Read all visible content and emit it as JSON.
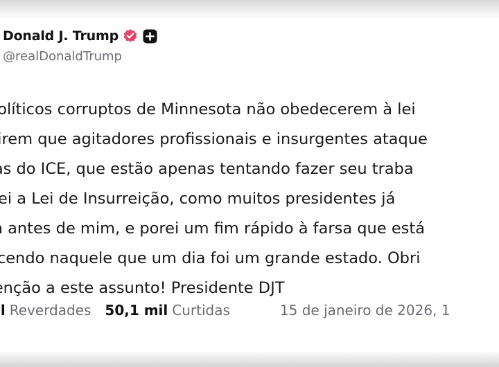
{
  "post": {
    "author": {
      "display_name": "Donald J. Trump",
      "handle": "@realDonaldTrump",
      "verified_badge_color": "#e3456a"
    },
    "text_lines": [
      "políticos corruptos de Minnesota não obedecerem à lei",
      "direm que agitadores profissionais e insurgentes ataque",
      "tas do ICE, que estão apenas tentando fazer seu traba",
      "írei a Lei de Insurreição, como muitos presidentes já",
      "m antes de mim, e porei um fim rápido à farsa que está",
      "ecendo naquele que um dia foi um grande estado. Obri",
      "tenção a este assunto! Presidente DJT"
    ],
    "stats": {
      "reposts_number": "il",
      "reposts_label": "Reverdades",
      "likes_number": "50,1 mil",
      "likes_label": "Curtidas",
      "date": "15 de janeiro de 2026, 1"
    }
  }
}
